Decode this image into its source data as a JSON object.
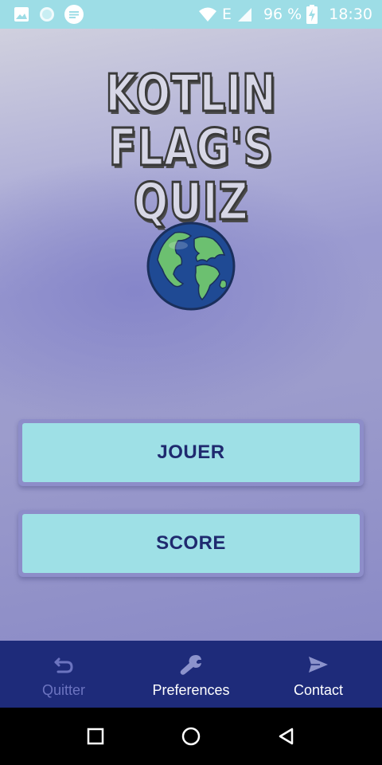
{
  "status_bar": {
    "network": "E",
    "battery": "96 %",
    "time": "18:30"
  },
  "app": {
    "title_line1": "KOTLIN FLAG'S",
    "title_line2": "QUIZ",
    "logo_icon": "globe-icon",
    "buttons": {
      "play": "JOUER",
      "score": "SCORE"
    }
  },
  "bottom_nav": {
    "items": [
      {
        "label": "Quitter",
        "icon": "back-arrow-icon",
        "state": "dimmed"
      },
      {
        "label": "Preferences",
        "icon": "wrench-icon",
        "state": "active"
      },
      {
        "label": "Contact",
        "icon": "send-icon",
        "state": "active"
      }
    ]
  },
  "system_nav": {
    "icons": [
      "recents-icon",
      "home-icon",
      "back-icon"
    ]
  },
  "colors": {
    "status_bar": "#9ddde6",
    "button_fill": "#9ee0e6",
    "button_text": "#1f2a6f",
    "nav_background": "#1e2b7a",
    "nav_dimmed": "#6c74c0"
  }
}
